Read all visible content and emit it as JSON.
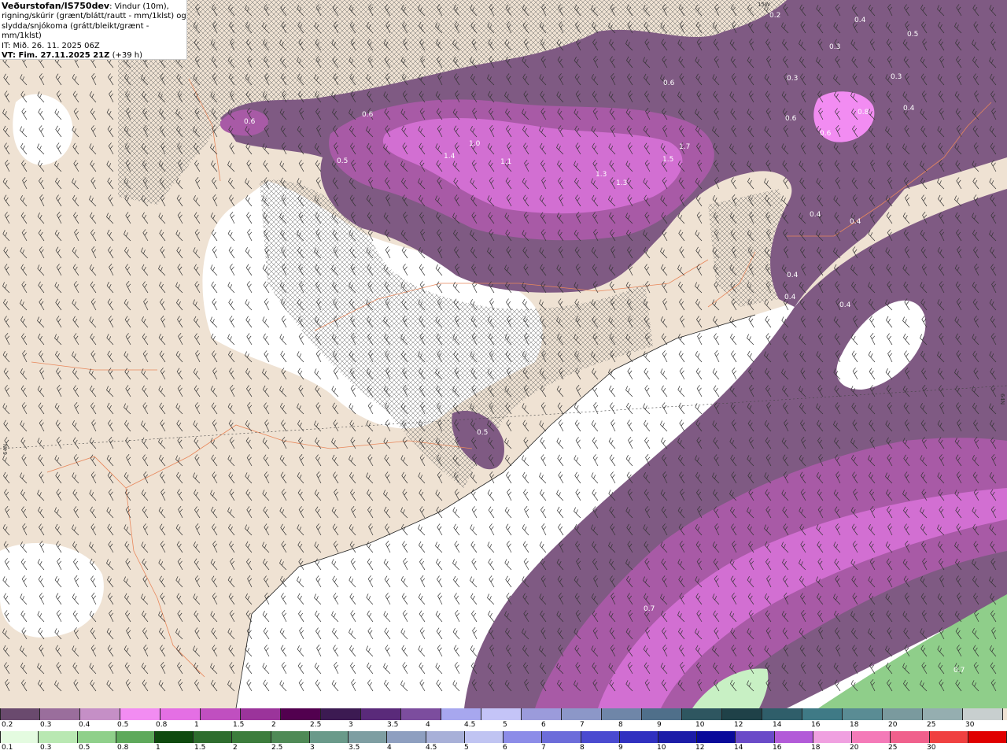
{
  "header": {
    "source": "Veðurstofan/IS750dev",
    "description": ": Vindur (10m), rigning/skúrir (grænt/blátt/rautt - mm/1klst) og slydda/snjókoma (grátt/bleikt/grænt - mm/1klst)",
    "issue_time": "IT: Mið. 26. 11. 2025 06Z",
    "valid_time": "VT: Fim. 27.11.2025 21Z",
    "lead": "(+39 h)"
  },
  "edge_labels": {
    "top": "15W",
    "left": "64N",
    "right": "64N"
  },
  "map_labels": [
    {
      "text": "0.2"
    },
    {
      "text": "0.4"
    },
    {
      "text": "0.5"
    },
    {
      "text": "0.3"
    },
    {
      "text": "0.3"
    },
    {
      "text": "0.3"
    },
    {
      "text": "0.6"
    },
    {
      "text": "0.6"
    },
    {
      "text": "0.6"
    },
    {
      "text": "0.4"
    },
    {
      "text": "0.6"
    },
    {
      "text": "0.8"
    },
    {
      "text": "0.6"
    },
    {
      "text": "1.4"
    },
    {
      "text": "1.0"
    },
    {
      "text": "1.1"
    },
    {
      "text": "1.3"
    },
    {
      "text": "1.3"
    },
    {
      "text": "1.7"
    },
    {
      "text": "1.5"
    },
    {
      "text": "0.5"
    },
    {
      "text": "0.4"
    },
    {
      "text": "0.4"
    },
    {
      "text": "0.4"
    },
    {
      "text": "0.4"
    },
    {
      "text": "0.4"
    },
    {
      "text": "0.5"
    },
    {
      "text": "0.7"
    },
    {
      "text": "0.7"
    }
  ],
  "colors": {
    "land": "#efe2d3",
    "sea": "#ffffff",
    "snow_light": "#7f5a83",
    "snow_mid": "#a85aa6",
    "snow_strong": "#d26fd2",
    "snow_peak": "#f28cf2",
    "rain_light": "#c8f0c4",
    "rain_mid": "#8fce8a"
  },
  "legend": {
    "snow_colors": [
      "#6a4a6e",
      "#9a6e9c",
      "#c58fc6",
      "#f28cf2",
      "#e46fe4",
      "#c04fc0",
      "#9b349b",
      "#52004f",
      "#3c1a52",
      "#5a2a7a",
      "#7c4d9e",
      "#a7a7ef",
      "#c4c4f7",
      "#9b9bdb",
      "#8c97c8",
      "#6f86a8",
      "#4f6f8a",
      "#2e5660",
      "#1f4148",
      "#2f5e6a",
      "#3f7a86",
      "#5a8c94",
      "#7a9a9e",
      "#95aeb0",
      "#c8cfcf"
    ],
    "snow_labels": [
      "0.2",
      "0.3",
      "0.4",
      "0.5",
      "0.8",
      "1",
      "1.5",
      "2",
      "2.5",
      "3",
      "3.5",
      "4",
      "4.5",
      "5",
      "6",
      "7",
      "8",
      "9",
      "10",
      "12",
      "14",
      "16",
      "18",
      "20",
      "25",
      "30"
    ],
    "rain_colors": [
      "#e4fbe0",
      "#b9e8b2",
      "#8fd08a",
      "#5ea95b",
      "#0f4a0f",
      "#2e6d2e",
      "#3c7d3c",
      "#4f8a56",
      "#6a9a8a",
      "#7e9ea2",
      "#8e9fc0",
      "#a8b0d8",
      "#c0c4f2",
      "#8c8ce8",
      "#6c6cda",
      "#4a4ad0",
      "#3030c0",
      "#1c1ca8",
      "#0a0a9a",
      "#6a4ac8",
      "#b25ad8",
      "#f0a0e0",
      "#f47ab8",
      "#f0608c",
      "#f04040",
      "#e00000"
    ],
    "rain_labels": [
      "0.1",
      "0.3",
      "0.5",
      "0.8",
      "1",
      "1.5",
      "2",
      "2.5",
      "3",
      "3.5",
      "4",
      "4.5",
      "5",
      "6",
      "7",
      "8",
      "9",
      "10",
      "12",
      "14",
      "16",
      "18",
      "20",
      "25",
      "30"
    ]
  }
}
